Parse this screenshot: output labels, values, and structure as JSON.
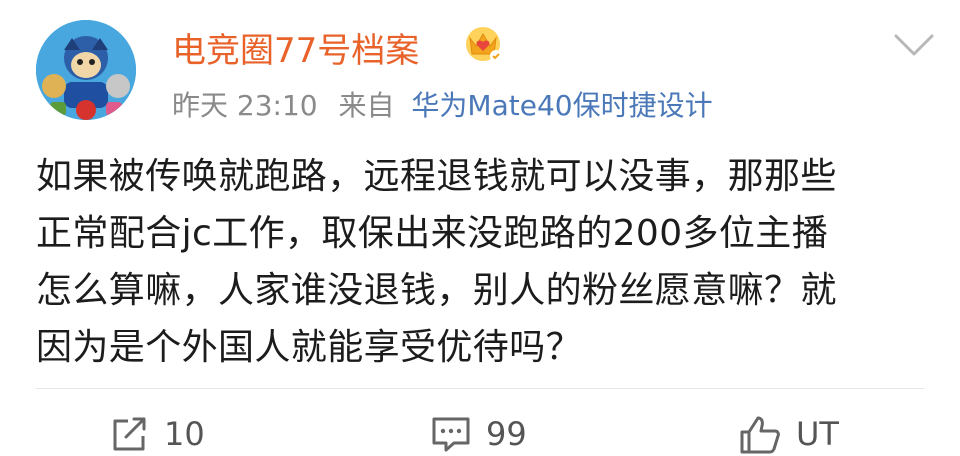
{
  "user": {
    "name": "电竞圈77号档案"
  },
  "meta": {
    "time": "昨天 23:10",
    "from_label": "来自",
    "source": "华为Mate40保时捷设计"
  },
  "post": {
    "lines": [
      "如果被传唤就跑路，远程退钱就可以没事，那那些",
      "正常配合jc工作，取保出来没跑路的200多位主播",
      "怎么算嘛，人家谁没退钱，别人的粉丝愿意嘛？就",
      "因为是个外国人就能享受优待吗？"
    ]
  },
  "actions": {
    "repost_count": "10",
    "comment_count": "99",
    "like_count": "UT"
  },
  "icons": {
    "crown": "vip-crown-icon",
    "more": "chevron-down-icon",
    "repost": "repost-icon",
    "comment": "comment-icon",
    "like": "like-icon"
  },
  "colors": {
    "username": "#e8622a",
    "source": "#4a78b8",
    "meta": "#8a8a8a"
  }
}
